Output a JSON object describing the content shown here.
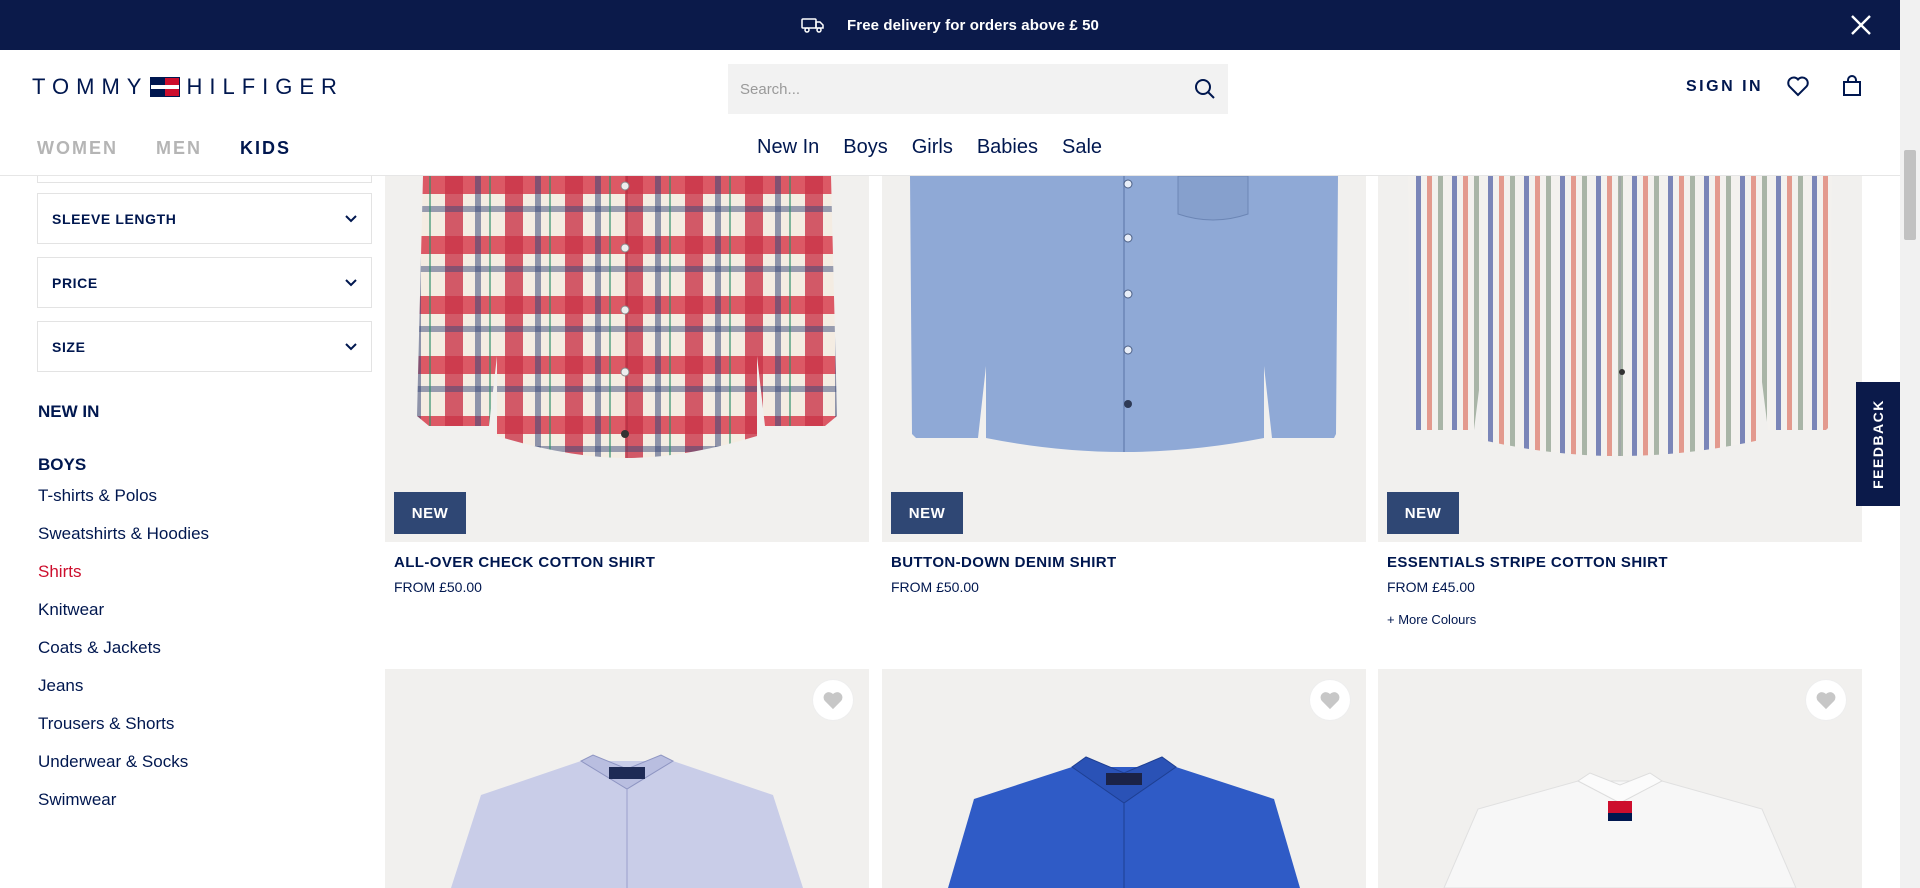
{
  "promo": {
    "text": "Free delivery for orders above £ 50",
    "icon": "truck-icon",
    "close_icon": "close-icon"
  },
  "header": {
    "logo_left": "TOMMY",
    "logo_right": "HILFIGER",
    "search_placeholder": "Search...",
    "sign_in": "SIGN IN",
    "gender_tabs": [
      {
        "label": "WOMEN",
        "active": false
      },
      {
        "label": "MEN",
        "active": false
      },
      {
        "label": "KIDS",
        "active": true
      }
    ],
    "category_nav": [
      "New In",
      "Boys",
      "Girls",
      "Babies",
      "Sale"
    ]
  },
  "sidebar": {
    "filters": [
      "SLEEVE LENGTH",
      "PRICE",
      "SIZE"
    ],
    "new_in": "NEW IN",
    "boys_heading": "BOYS",
    "boys_links": [
      {
        "label": "T-shirts & Polos",
        "active": false
      },
      {
        "label": "Sweatshirts & Hoodies",
        "active": false
      },
      {
        "label": "Shirts",
        "active": true
      },
      {
        "label": "Knitwear",
        "active": false
      },
      {
        "label": "Coats & Jackets",
        "active": false
      },
      {
        "label": "Jeans",
        "active": false
      },
      {
        "label": "Trousers & Shorts",
        "active": false
      },
      {
        "label": "Underwear & Socks",
        "active": false
      },
      {
        "label": "Swimwear",
        "active": false
      }
    ]
  },
  "products": [
    {
      "badge": "NEW",
      "name": "ALL-OVER CHECK COTTON SHIRT",
      "price": "FROM £50.00",
      "more": ""
    },
    {
      "badge": "NEW",
      "name": "BUTTON-DOWN DENIM SHIRT",
      "price": "FROM £50.00",
      "more": ""
    },
    {
      "badge": "NEW",
      "name": "ESSENTIALS STRIPE COTTON SHIRT",
      "price": "FROM £45.00",
      "more": "+ More Colours"
    }
  ],
  "feedback": "FEEDBACK",
  "colors": {
    "navy": "#0b1a4a",
    "brand_red": "#cd0e2d",
    "badge": "#2f4774",
    "image_bg": "#f1f0ee"
  }
}
